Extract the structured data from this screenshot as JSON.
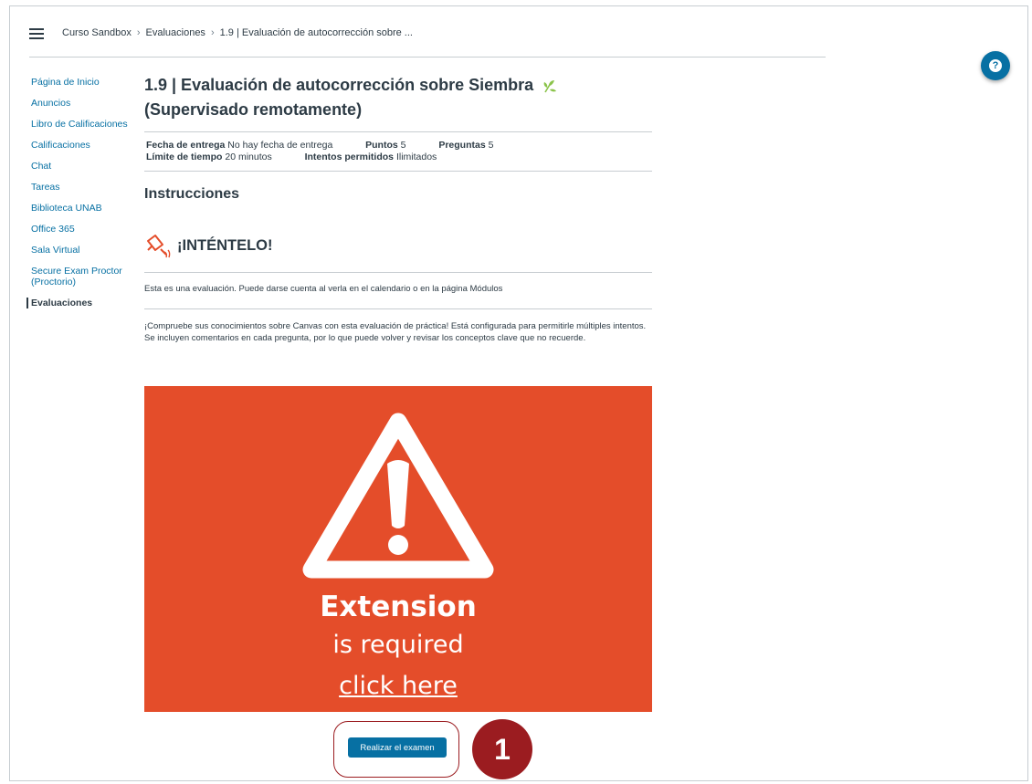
{
  "breadcrumb": [
    "Curso Sandbox",
    "Evaluaciones",
    "1.9 | Evaluación de autocorrección sobre ..."
  ],
  "nav": [
    "Página de Inicio",
    "Anuncios",
    "Libro de Calificaciones",
    "Calificaciones",
    "Chat",
    "Tareas",
    "Biblioteca UNAB",
    "Office 365",
    "Sala Virtual",
    "Secure Exam Proctor (Proctorio)",
    "Evaluaciones"
  ],
  "quiz": {
    "title_line1": "1.9 | Evaluación de autocorrección sobre Siembra",
    "title_line2": "(Supervisado remotamente)",
    "due_label": "Fecha de entrega",
    "due_value": "No hay fecha de entrega",
    "points_label": "Puntos",
    "points_value": "5",
    "questions_label": "Preguntas",
    "questions_value": "5",
    "time_label": "Límite de tiempo",
    "time_value": "20 minutos",
    "attempts_label": "Intentos permitidos",
    "attempts_value": "Ilimitados"
  },
  "instructions": {
    "heading": "Instrucciones",
    "try_heading": "¡INTÉNTELO!",
    "para1": "Esta es una evaluación. Puede darse cuenta al verla en el calendario o en la página Módulos",
    "para2": "¡Compruebe sus conocimientos sobre Canvas con esta evaluación de práctica! Está configurada para permitirle múltiples intentos. Se incluyen comentarios en cada pregunta, por lo que puede volver y revisar los conceptos clave que no recuerde."
  },
  "banner": {
    "title": "Extension",
    "subtitle": "is required",
    "link": "click here",
    "color": "#e44d2a"
  },
  "take_quiz_button": "Realizar el examen",
  "callout_number": "1",
  "colors": {
    "accent": "#0770a3",
    "callout": "#9b1c20"
  },
  "icons": [
    "hamburger-icon",
    "help-icon",
    "leaf-icon",
    "watering-can-icon",
    "warning-icon"
  ]
}
